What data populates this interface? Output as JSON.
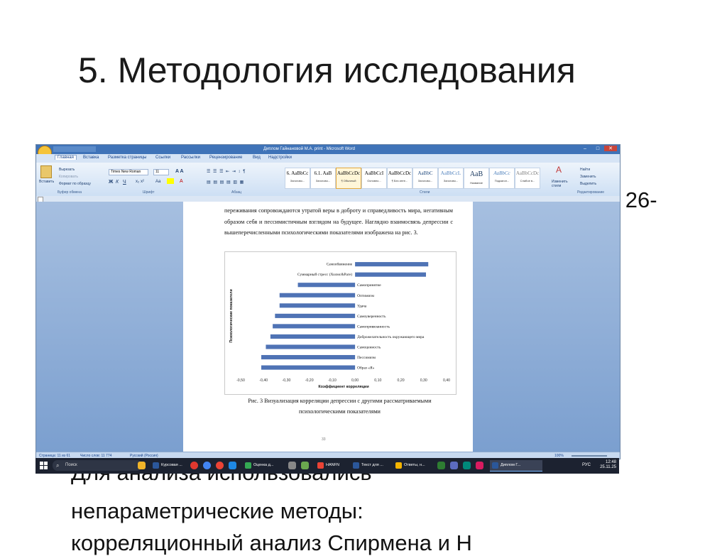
{
  "slide": {
    "title": "5. Методология исследования",
    "peek_right": "н 26-",
    "line1": "Для анализа использовались",
    "line2": "непараметрические методы:",
    "line3": "корреляционный анализ Спирмена и Н"
  },
  "word": {
    "window_title": "Диплом Гайнановой М.А. print - Microsoft Word",
    "tabs": [
      "Главная",
      "Вставка",
      "Разметка страницы",
      "Ссылки",
      "Рассылки",
      "Рецензирование",
      "Вид",
      "Надстройки"
    ],
    "clipboard": {
      "paste": "Вставить",
      "cut": "Вырезать",
      "copy": "Копировать",
      "format_painter": "Формат по образцу",
      "label": "Буфер обмена"
    },
    "font": {
      "name": "Times New Roman",
      "size": "11",
      "label": "Шрифт"
    },
    "paragraph_label": "Абзац",
    "styles": [
      {
        "preview": "6. AaBbCc",
        "label": "Заголово..."
      },
      {
        "preview": "6.1. AaB",
        "label": "Заголово..."
      },
      {
        "preview": "AaBbCcDc",
        "label": "¶ Обычный"
      },
      {
        "preview": "AaBbCcI",
        "label": "Основно..."
      },
      {
        "preview": "AaBbCcDc",
        "label": "¶ Без инте..."
      },
      {
        "preview": "AaBbC",
        "label": "Заголово..."
      },
      {
        "preview": "AaBbCcL",
        "label": "Заголово..."
      },
      {
        "preview": "AaB",
        "label": "Название"
      },
      {
        "preview": "AaBbCc",
        "label": "Подзагол..."
      },
      {
        "preview": "AaBbCcDc",
        "label": "Слабое в..."
      }
    ],
    "styles_label": "Стили",
    "change_styles": "Изменить стили",
    "editing": {
      "find": "Найти",
      "replace": "Заменить",
      "select": "Выделить",
      "label": "Редактирование"
    },
    "document": {
      "paragraph": "переживания сопровождаются утратой веры в доброту и справедливость мира, негативным образом себя и пессимистичным взглядом на будущее. Наглядно взаимосвязь депрессии с вышеперечисленными психологическими показателями изображена на рис. 3.",
      "caption": "Рис. 3 Визуализация корреляции депрессии с другими рассматриваемыми психологическими показателями",
      "page_number": "33"
    },
    "statusbar": {
      "page": "Страница: 11 из 61",
      "words": "Число слов: 11 774",
      "lang": "Русский (Россия)",
      "zoom": "100%"
    }
  },
  "taskbar": {
    "search": "Поиск",
    "apps": [
      {
        "label": "Курсовая ...",
        "color": "#2b579a"
      },
      {
        "label": "Оценка д...",
        "color": "#34a853"
      },
      {
        "label": "HANFN",
        "color": "#ea4335"
      },
      {
        "label": "Текст для ...",
        "color": "#2b579a"
      },
      {
        "label": "Ответы, н...",
        "color": "#f4b400"
      },
      {
        "label": "Диплом Г...",
        "color": "#2b579a"
      }
    ],
    "lang": "РУС",
    "time": "12:48",
    "date": "25.11.25"
  },
  "chart_data": {
    "type": "bar",
    "orientation": "horizontal",
    "categories": [
      "Самообвинение",
      "Суммарный стресс (Холмс&Раге)",
      "Самопринятие",
      "Оптимизм",
      "Удача",
      "Самоуверенность",
      "Самопривязанность",
      "Доброжелательность окружающего мира",
      "Самоценность",
      "Пессимизм",
      "Образ «Я»"
    ],
    "values": [
      0.32,
      0.31,
      -0.25,
      -0.33,
      -0.33,
      -0.35,
      -0.36,
      -0.37,
      -0.39,
      -0.41,
      -0.41
    ],
    "xlabel": "Коэффициент корреляции",
    "ylabel": "Психологические показатели",
    "xlim": [
      -0.5,
      0.4
    ],
    "xticks": [
      "-0,50",
      "-0,40",
      "-0,30",
      "-0,20",
      "-0,10",
      "0,00",
      "0,10",
      "0,20",
      "0,30",
      "0,40"
    ],
    "bar_color": "#4f73b5",
    "grid": false
  }
}
